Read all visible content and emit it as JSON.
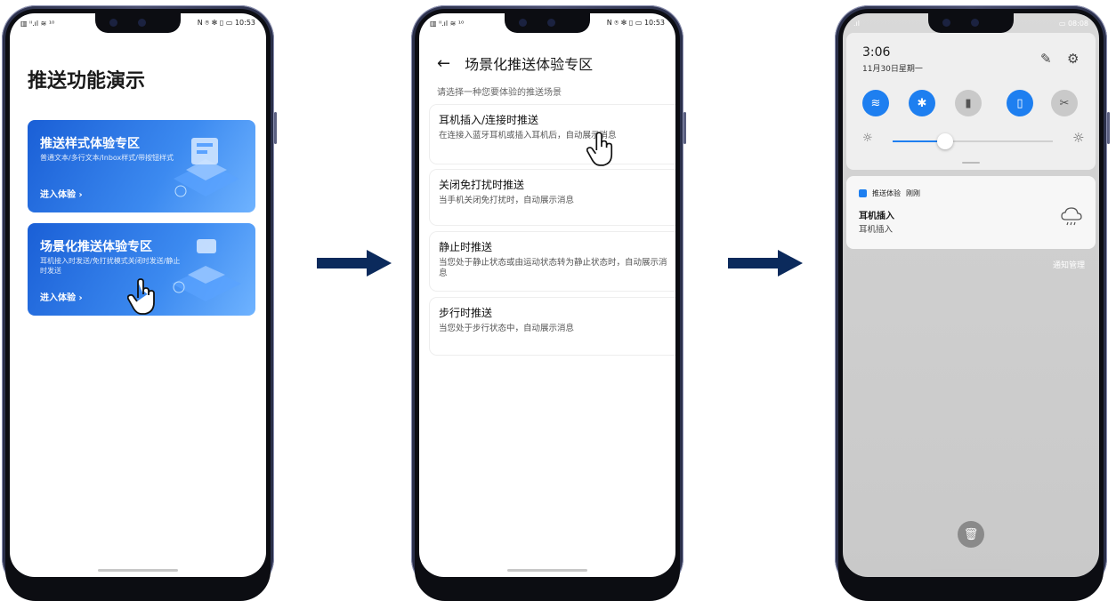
{
  "colors": {
    "arrow": "#0b2a5c",
    "accent": "#1e7ff0",
    "card": "#2f7ae8"
  },
  "phone1": {
    "status_left": "▥ ᴵᴵ.ıl ≋ ¹⁰",
    "status_right": "N ⍟ ✻ ▯ ▭ 10:53",
    "title": "推送功能演示",
    "cards": [
      {
        "title": "推送样式体验专区",
        "desc": "普通文本/多行文本/Inbox样式/带按钮样式",
        "enter": "进入体验 ›"
      },
      {
        "title": "场景化推送体验专区",
        "desc": "耳机接入时发送/免打扰模式关闭时发送/静止时发送",
        "enter": "进入体验 ›"
      }
    ]
  },
  "phone2": {
    "status_left": "▥ ᴵᴵ.ıl ≋ ¹⁰",
    "status_right": "N ⍟ ✻ ▯ ▭ 10:53",
    "back_icon": "←",
    "title": "场景化推送体验专区",
    "subtitle": "请选择一种您要体验的推送场景",
    "items": [
      {
        "title": "耳机插入/连接时推送",
        "desc": "在连接入蓝牙耳机或插入耳机后，自动展示消息"
      },
      {
        "title": "关闭免打扰时推送",
        "desc": "当手机关闭免打扰时，自动展示消息"
      },
      {
        "title": "静止时推送",
        "desc": "当您处于静止状态或由运动状态转为静止状态时，自动展示消息"
      },
      {
        "title": "步行时推送",
        "desc": "当您处于步行状态中，自动展示消息"
      }
    ]
  },
  "phone3": {
    "status_left": ".ıl",
    "status_right": "▭ 08:08",
    "time": "3:06",
    "date": "11月30日星期一",
    "edit_icon": "✎",
    "settings_icon": "⚙",
    "toggles": [
      {
        "icon": "wifi-icon",
        "glyph": "≋",
        "on": true
      },
      {
        "icon": "bluetooth-icon",
        "glyph": "✱",
        "on": true
      },
      {
        "icon": "flashlight-icon",
        "glyph": "▮",
        "on": false
      },
      {
        "icon": "vibrate-icon",
        "glyph": "▯",
        "on": true
      },
      {
        "icon": "screenshot-icon",
        "glyph": "✂",
        "on": false
      }
    ],
    "brightness": 0.33,
    "notification": {
      "app": "推送体验",
      "when": "刚刚",
      "title": "耳机插入",
      "body": "耳机插入"
    },
    "manage": "通知管理",
    "trash_icon": "🗑"
  }
}
